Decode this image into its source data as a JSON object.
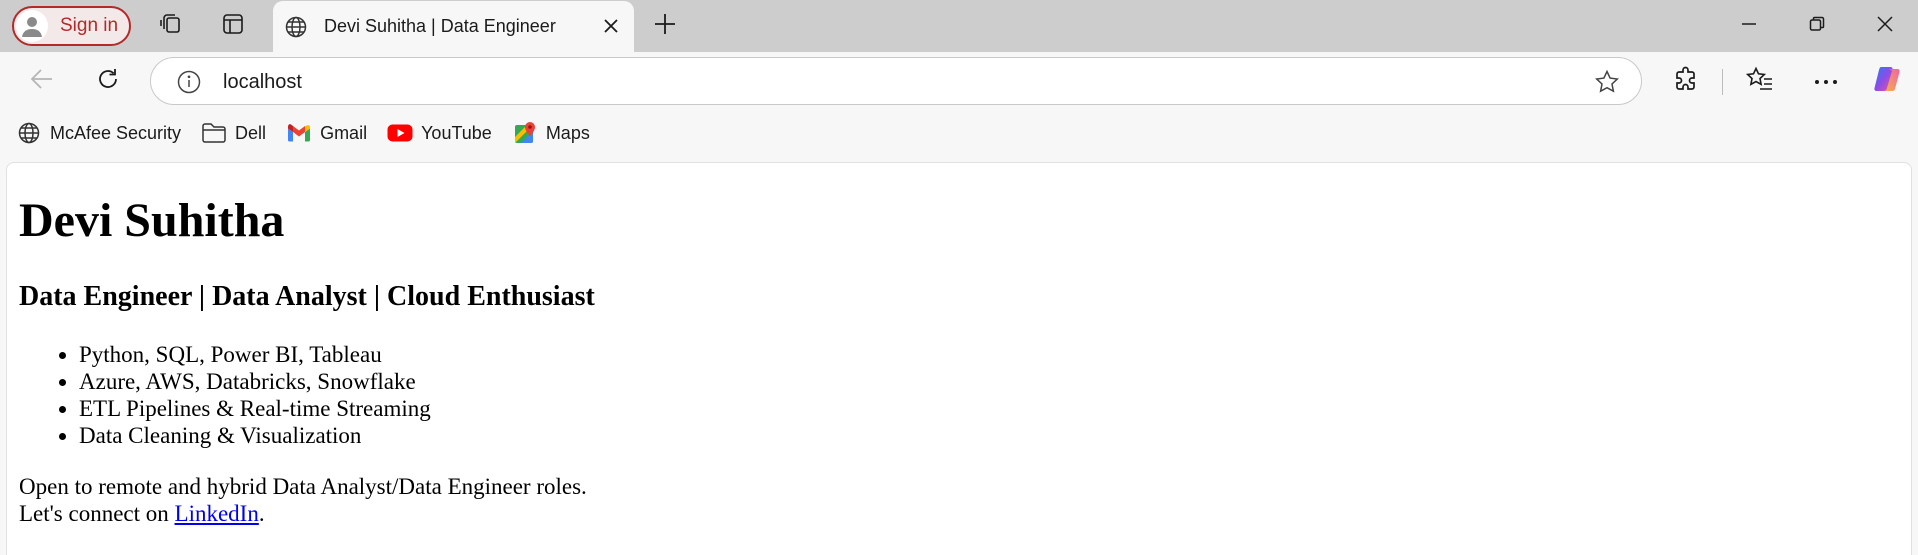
{
  "browser": {
    "signin_label": "Sign in",
    "tab": {
      "title": "Devi Suhitha | Data Engineer",
      "icon": "globe-icon"
    },
    "address": {
      "url": "localhost"
    },
    "bookmarks": [
      {
        "label": "McAfee Security",
        "icon": "globe-icon"
      },
      {
        "label": "Dell",
        "icon": "folder-icon"
      },
      {
        "label": "Gmail",
        "icon": "gmail-icon"
      },
      {
        "label": "YouTube",
        "icon": "youtube-icon"
      },
      {
        "label": "Maps",
        "icon": "maps-icon"
      }
    ],
    "colors": {
      "signin_accent": "#b22a2a",
      "tabstrip": "#cdcdcd",
      "link": "#0000ee"
    }
  },
  "page": {
    "name": "Devi Suhitha",
    "tagline": "Data Engineer | Data Analyst | Cloud Enthusiast",
    "skills": [
      "Python, SQL, Power BI, Tableau",
      "Azure, AWS, Databricks, Snowflake",
      "ETL Pipelines & Real-time Streaming",
      "Data Cleaning & Visualization"
    ],
    "open_to": "Open to remote and hybrid Data Analyst/Data Engineer roles.",
    "connect_prefix": "Let's connect on ",
    "connect_link": "LinkedIn",
    "connect_suffix": "."
  }
}
